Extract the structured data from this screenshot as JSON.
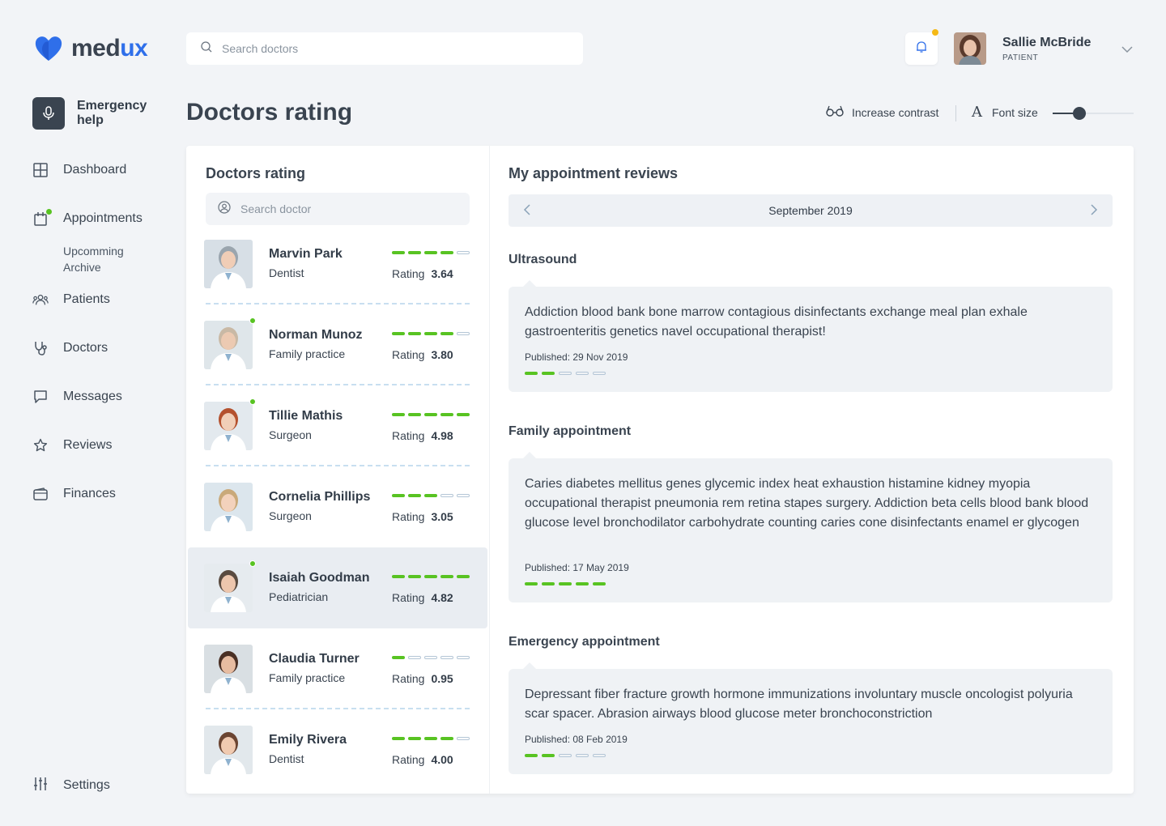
{
  "brand": {
    "name_a": "med",
    "name_b": "ux",
    "colors": {
      "blue": "#2f6fea",
      "green": "#58c322",
      "dark": "#3a4450"
    }
  },
  "emergency": {
    "label": "Emergency help",
    "icon": "microphone-icon"
  },
  "nav": {
    "items": [
      {
        "label": "Dashboard",
        "icon": "grid-icon"
      },
      {
        "label": "Appointments",
        "icon": "calendar-icon"
      },
      {
        "label": "Patients",
        "icon": "users-icon"
      },
      {
        "label": "Doctors",
        "icon": "stethoscope-icon"
      },
      {
        "label": "Messages",
        "icon": "chat-icon"
      },
      {
        "label": "Reviews",
        "icon": "star-icon"
      },
      {
        "label": "Finances",
        "icon": "wallet-icon"
      }
    ],
    "sub": [
      "Upcomming",
      "Archive"
    ],
    "settings": "Settings"
  },
  "header": {
    "search_placeholder": "Search doctors",
    "user": {
      "name": "Sallie McBride",
      "role": "PATIENT"
    }
  },
  "page": {
    "title": "Doctors rating",
    "contrast_label": "Increase contrast",
    "font_label": "Font size",
    "font_size_level": 0.3
  },
  "doctors_panel": {
    "title": "Doctors rating",
    "search_placeholder": "Search doctor",
    "rating_label": "Rating",
    "doctors": [
      {
        "name": "Marvin Park",
        "specialty": "Dentist",
        "rating": "3.64",
        "bars": 4,
        "online": false,
        "selected": false
      },
      {
        "name": "Norman Munoz",
        "specialty": "Family practice",
        "rating": "3.80",
        "bars": 4,
        "online": true,
        "selected": false
      },
      {
        "name": "Tillie Mathis",
        "specialty": "Surgeon",
        "rating": "4.98",
        "bars": 5,
        "online": true,
        "selected": false
      },
      {
        "name": "Cornelia Phillips",
        "specialty": "Surgeon",
        "rating": "3.05",
        "bars": 3,
        "online": false,
        "selected": false
      },
      {
        "name": "Isaiah Goodman",
        "specialty": "Pediatrician",
        "rating": "4.82",
        "bars": 5,
        "online": true,
        "selected": true
      },
      {
        "name": "Claudia Turner",
        "specialty": "Family practice",
        "rating": "0.95",
        "bars": 1,
        "online": false,
        "selected": false
      },
      {
        "name": "Emily Rivera",
        "specialty": "Dentist",
        "rating": "4.00",
        "bars": 4,
        "online": false,
        "selected": false
      }
    ]
  },
  "reviews_panel": {
    "title": "My appointment reviews",
    "month": "September 2019",
    "reviews": [
      {
        "type": "Ultrasound",
        "text": "Addiction blood bank bone marrow contagious disinfectants exchange meal plan exhale gastroenteritis genetics navel occupational therapist!",
        "published": "Published: 29 Nov 2019",
        "bars": 2
      },
      {
        "type": "Family appointment",
        "text": "Caries diabetes mellitus genes glycemic index heat exhaustion histamine kidney myopia occupational therapist pneumonia rem retina stapes surgery. Addiction beta cells blood bank blood glucose level bronchodilator carbohydrate counting caries cone disinfectants enamel er glycogen",
        "published": "Published: 17 May 2019",
        "bars": 5
      },
      {
        "type": "Emergency appointment",
        "text": "Depressant fiber fracture growth hormone immunizations involuntary muscle oncologist polyuria scar spacer. Abrasion airways blood glucose meter bronchoconstriction",
        "published": "Published: 08 Feb 2019",
        "bars": 2
      }
    ]
  }
}
